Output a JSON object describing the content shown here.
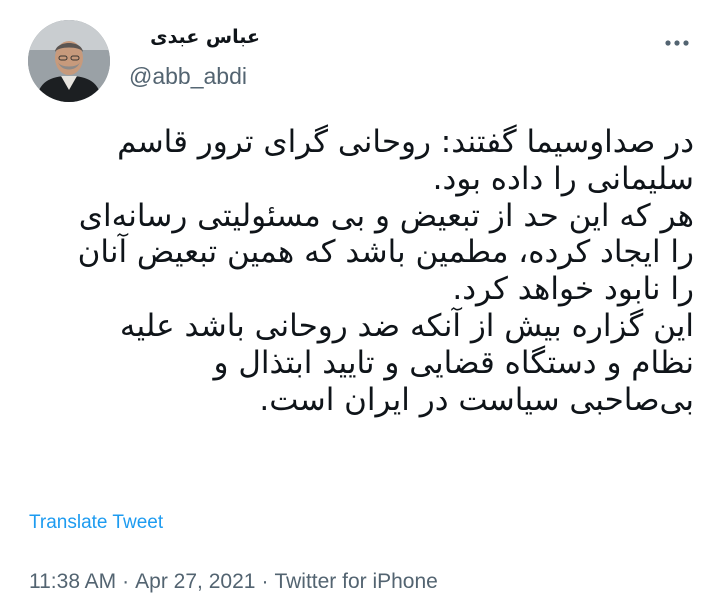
{
  "author": {
    "display_name": "عباس عبدی",
    "handle": "@abb_abdi",
    "avatar_icon": "profile-photo"
  },
  "menu": {
    "icon": "more-horizontal-icon"
  },
  "tweet": {
    "lines": [
      "در صداوسیما گفتند: روحانی گرای ترور قاسم",
      "سلیمانی را داده بود.",
      "هر که این حد از تبعیض و بی مسئولیتی رسانه‌ای",
      "را ایجاد کرده، مطمین باشد که همین تبعیض آنان",
      "را نابود خواهد کرد.",
      "این گزاره بیش از آنکه ضد روحانی باشد علیه",
      "نظام و دستگاه قضایی و تایید ابتذال و",
      "بی‌صاحبی سیاست در ایران است."
    ],
    "translate_label": "Translate Tweet"
  },
  "meta": {
    "time": "11:38 AM",
    "separator": "·",
    "date": "Apr 27, 2021",
    "source": "Twitter for iPhone"
  },
  "colors": {
    "link": "#1d9bf0",
    "secondary_text": "#536471",
    "primary_text": "#0f1419"
  }
}
